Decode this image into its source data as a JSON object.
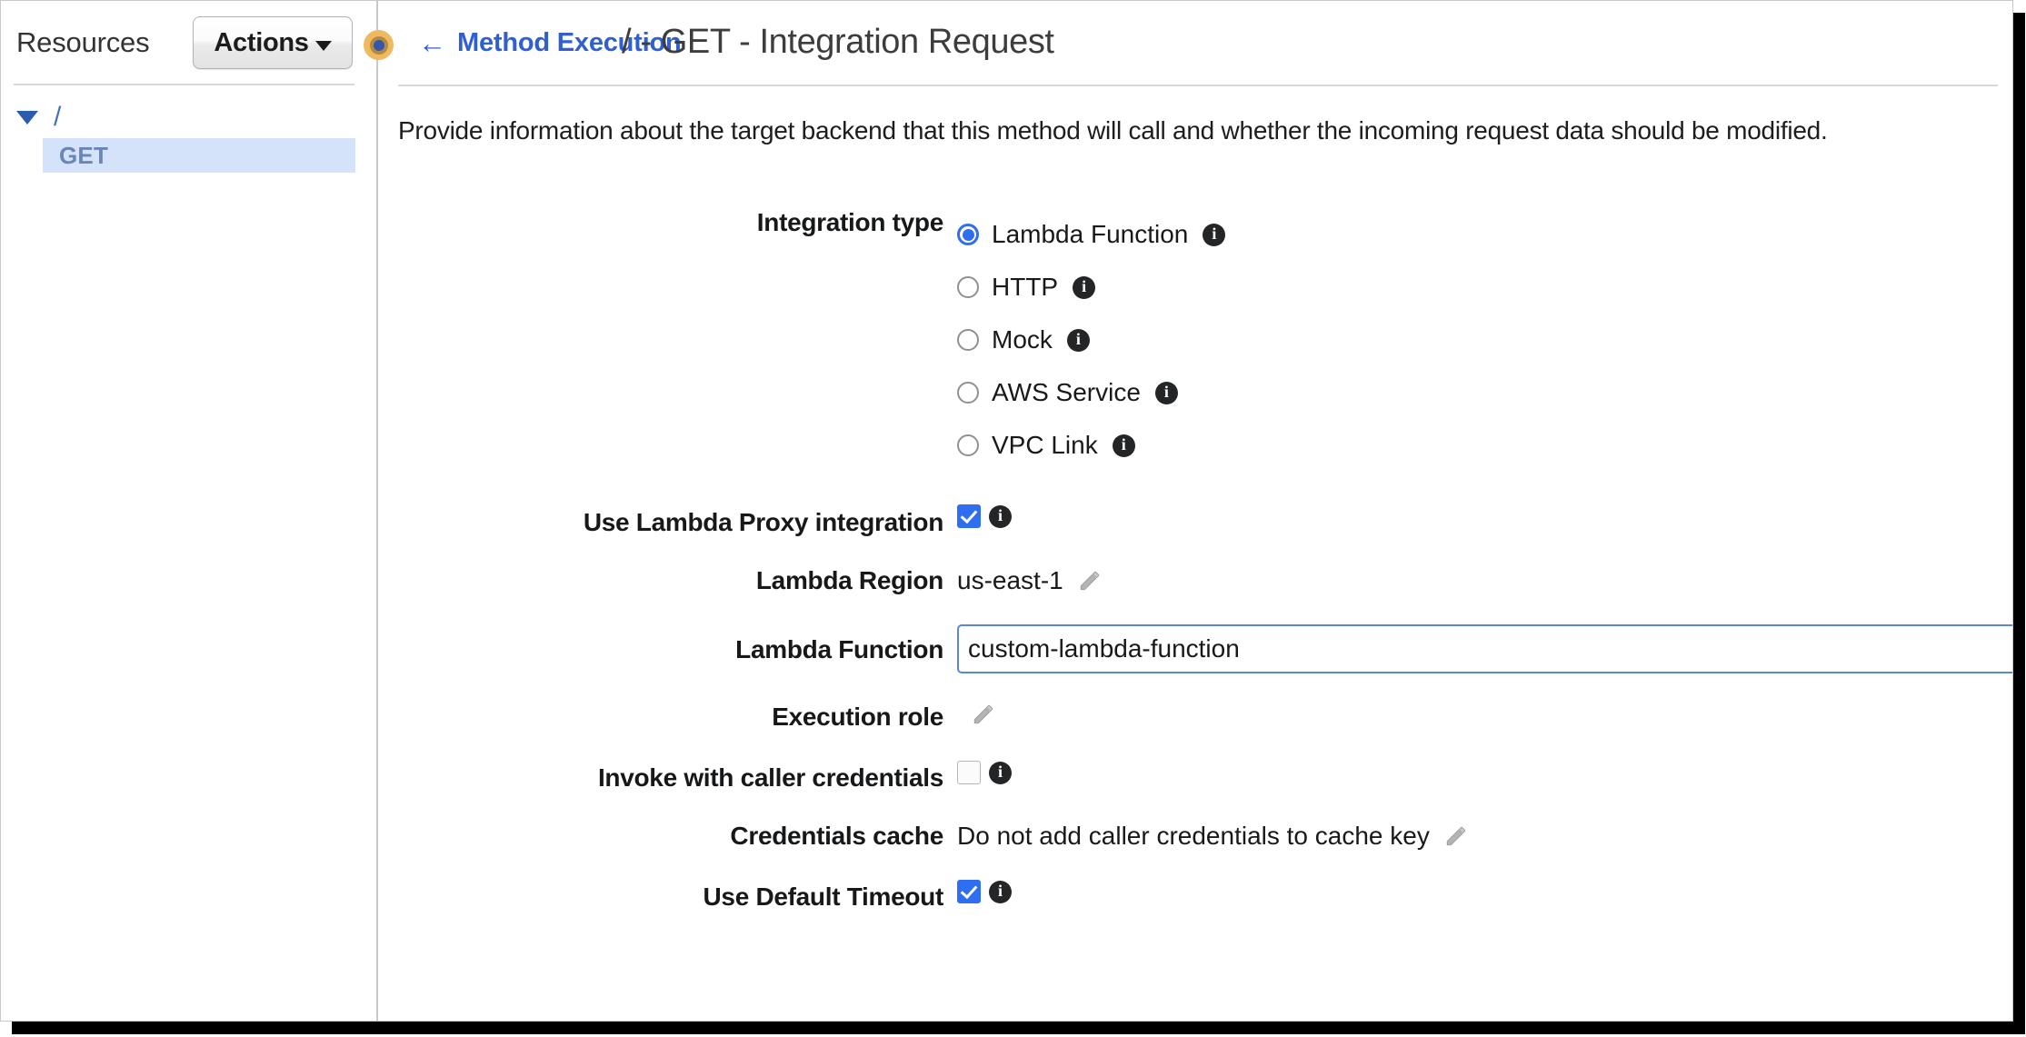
{
  "sidebar": {
    "title": "Resources",
    "actions_button": "Actions",
    "tree": {
      "root_label": "/",
      "method_label": "GET"
    }
  },
  "splitter": {
    "icon": "drag-handle-icon"
  },
  "main": {
    "back_link": "Method Execution",
    "back_arrow": "←",
    "page_title": "/ - GET - Integration Request",
    "description": "Provide information about the target backend that this method will call and whether the incoming request data should be modified.",
    "form": {
      "integration_type": {
        "label": "Integration type",
        "selected": "Lambda Function",
        "options": [
          {
            "label": "Lambda Function",
            "selected": true
          },
          {
            "label": "HTTP",
            "selected": false
          },
          {
            "label": "Mock",
            "selected": false
          },
          {
            "label": "AWS Service",
            "selected": false
          },
          {
            "label": "VPC Link",
            "selected": false
          }
        ]
      },
      "use_lambda_proxy": {
        "label": "Use Lambda Proxy integration",
        "checked": true
      },
      "lambda_region": {
        "label": "Lambda Region",
        "value": "us-east-1"
      },
      "lambda_function": {
        "label": "Lambda Function",
        "value": "custom-lambda-function",
        "placeholder": ""
      },
      "execution_role": {
        "label": "Execution role",
        "value": ""
      },
      "invoke_with_caller_credentials": {
        "label": "Invoke with caller credentials",
        "checked": false
      },
      "credentials_cache": {
        "label": "Credentials cache",
        "value": "Do not add caller credentials to cache key"
      },
      "use_default_timeout": {
        "label": "Use Default Timeout",
        "checked": true
      }
    }
  },
  "colors": {
    "accent_blue": "#2f6ef0",
    "link_blue": "#2f5fd0",
    "selected_row_bg": "#d4e3f9",
    "method_text": "#6a85b8",
    "splitter_orange": "#efba5f"
  }
}
